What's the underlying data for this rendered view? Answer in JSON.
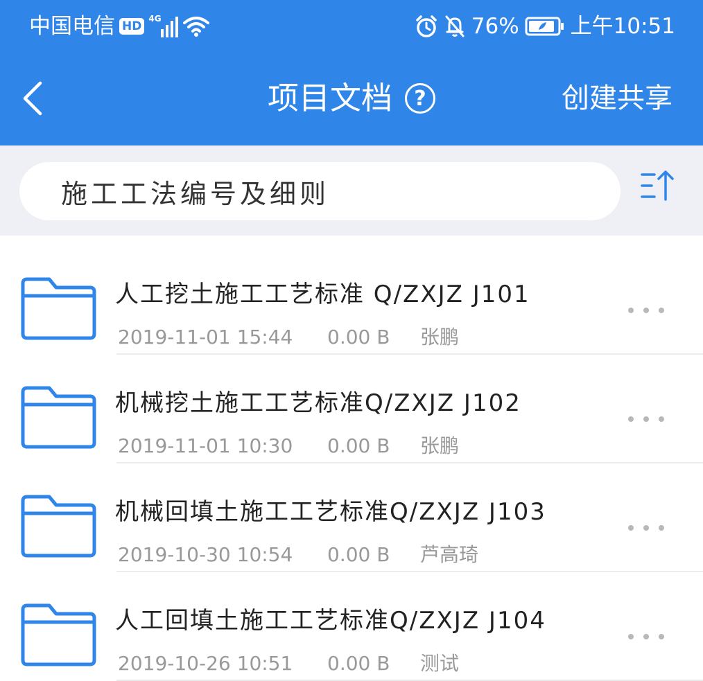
{
  "status_bar": {
    "carrier": "中国电信",
    "hd_badge": "HD",
    "network": "4G",
    "battery_percent": "76%",
    "time": "上午10:51",
    "icons": [
      "hd-icon",
      "signal-icon",
      "wifi-icon",
      "alarm-icon",
      "mute-bell-icon",
      "battery-icon"
    ]
  },
  "nav": {
    "title": "项目文档",
    "help_symbol": "?",
    "create_share_label": "创建共享",
    "back_icon": "chevron-left-icon"
  },
  "folder_bar": {
    "current_folder": "施工工法编号及细则",
    "sort_icon": "sort-ascending-icon"
  },
  "files": [
    {
      "name": "人工挖土施工工艺标准  Q/ZXJZ  J101",
      "date": "2019-11-01 15:44",
      "size": "0.00 B",
      "owner": "张鹏"
    },
    {
      "name": "机械挖土施工工艺标准Q/ZXJZ  J102",
      "date": "2019-11-01 10:30",
      "size": "0.00 B",
      "owner": "张鹏"
    },
    {
      "name": "机械回填土施工工艺标准Q/ZXJZ  J103",
      "date": "2019-10-30 10:54",
      "size": "0.00 B",
      "owner": "芦高琦"
    },
    {
      "name": "人工回填土施工工艺标准Q/ZXJZ  J104",
      "date": "2019-10-26 10:51",
      "size": "0.00 B",
      "owner": "测试"
    }
  ],
  "colors": {
    "header_blue": "#2f85e8",
    "folder_icon_blue": "#2f85e8",
    "sort_icon_blue": "#2f85e8",
    "page_background": "#f3f4f8"
  }
}
